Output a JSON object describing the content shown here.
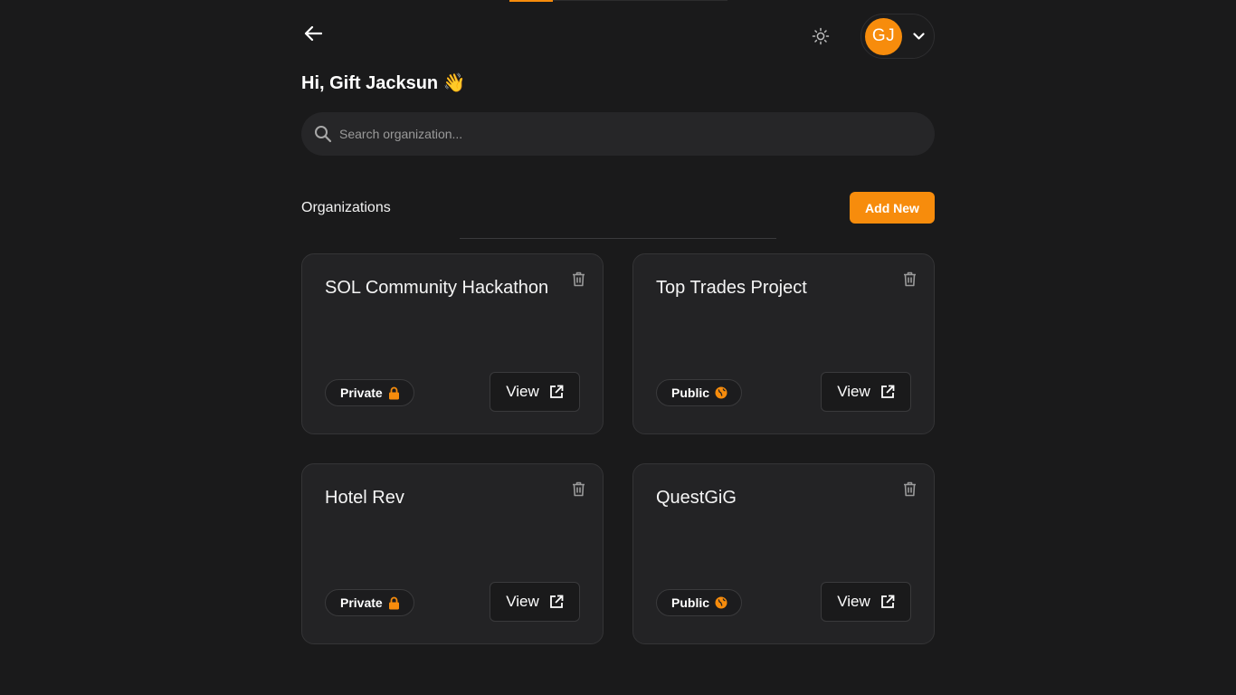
{
  "header": {
    "greeting": "Hi, Gift Jacksun 👋",
    "avatar_initials": "GJ",
    "progress_percent": 20
  },
  "search": {
    "placeholder": "Search organization..."
  },
  "section": {
    "title": "Organizations",
    "add_new_label": "Add New"
  },
  "colors": {
    "accent": "#f78c0c",
    "background": "#1a1a1b",
    "card": "#232325"
  },
  "organizations": [
    {
      "name": "SOL Community Hackathon",
      "visibility": "Private",
      "visibility_icon": "lock-icon",
      "view_label": "View"
    },
    {
      "name": "Top Trades Project",
      "visibility": "Public",
      "visibility_icon": "globe-icon",
      "view_label": "View"
    },
    {
      "name": "Hotel Rev",
      "visibility": "Private",
      "visibility_icon": "lock-icon",
      "view_label": "View"
    },
    {
      "name": "QuestGiG",
      "visibility": "Public",
      "visibility_icon": "globe-icon",
      "view_label": "View"
    }
  ]
}
